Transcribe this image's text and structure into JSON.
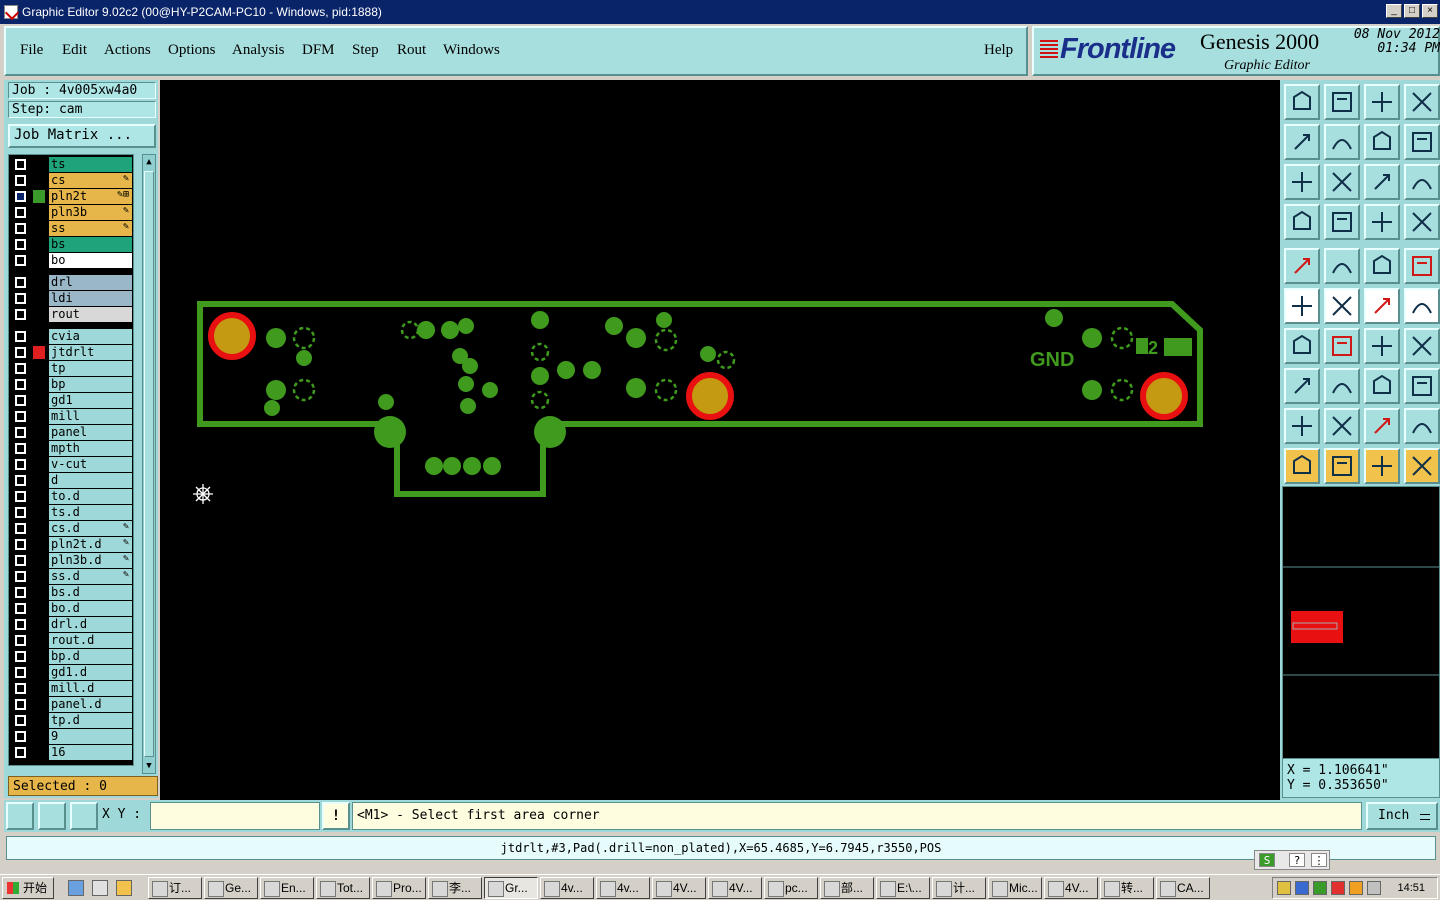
{
  "window": {
    "title": "Graphic Editor 9.02c2 (00@HY-P2CAM-PC10 - Windows, pid:1888)"
  },
  "menu": [
    "File",
    "Edit",
    "Actions",
    "Options",
    "Analysis",
    "DFM",
    "Step",
    "Rout",
    "Windows"
  ],
  "help_label": "Help",
  "brand": {
    "logo": "Frontline",
    "product": "Genesis 2000",
    "subtitle": "Graphic Editor",
    "date": "08 Nov 2012",
    "time": "01:34 PM"
  },
  "job": {
    "job_label": "Job : 4v005xw4a0",
    "step_label": "Step: cam",
    "matrix_button": "Job Matrix ..."
  },
  "layers": [
    {
      "name": "ts",
      "color": "#1fa37a",
      "edit": ""
    },
    {
      "name": "cs",
      "color": "#e6b64a",
      "edit": "✎"
    },
    {
      "name": "pln2t",
      "color": "#e6b64a",
      "edit": "✎⊞",
      "active": true,
      "swatch": "#3a9a2a"
    },
    {
      "name": "pln3b",
      "color": "#e6b64a",
      "edit": "✎"
    },
    {
      "name": "ss",
      "color": "#e6b64a",
      "edit": "✎"
    },
    {
      "name": "bs",
      "color": "#1fa37a",
      "edit": ""
    },
    {
      "name": "bo",
      "color": "#ffffff",
      "edit": ""
    },
    {
      "name": "drl",
      "color": "#9ab7c7",
      "edit": ""
    },
    {
      "name": "ldi",
      "color": "#9ab7c7",
      "edit": ""
    },
    {
      "name": "rout",
      "color": "#d8d8d8",
      "edit": ""
    },
    {
      "name": "cvia",
      "color": "#9fd8d8",
      "edit": ""
    },
    {
      "name": "jtdrlt",
      "color": "#9fd8d8",
      "edit": "",
      "swatch": "#e02020"
    },
    {
      "name": "tp",
      "color": "#9fd8d8",
      "edit": ""
    },
    {
      "name": "bp",
      "color": "#9fd8d8",
      "edit": ""
    },
    {
      "name": "gd1",
      "color": "#9fd8d8",
      "edit": ""
    },
    {
      "name": "mill",
      "color": "#9fd8d8",
      "edit": ""
    },
    {
      "name": "panel",
      "color": "#9fd8d8",
      "edit": ""
    },
    {
      "name": "mpth",
      "color": "#9fd8d8",
      "edit": ""
    },
    {
      "name": "v-cut",
      "color": "#9fd8d8",
      "edit": ""
    },
    {
      "name": "d",
      "color": "#9fd8d8",
      "edit": ""
    },
    {
      "name": "to.d",
      "color": "#9fd8d8",
      "edit": ""
    },
    {
      "name": "ts.d",
      "color": "#9fd8d8",
      "edit": ""
    },
    {
      "name": "cs.d",
      "color": "#9fd8d8",
      "edit": "✎"
    },
    {
      "name": "pln2t.d",
      "color": "#9fd8d8",
      "edit": "✎"
    },
    {
      "name": "pln3b.d",
      "color": "#9fd8d8",
      "edit": "✎"
    },
    {
      "name": "ss.d",
      "color": "#9fd8d8",
      "edit": "✎"
    },
    {
      "name": "bs.d",
      "color": "#9fd8d8",
      "edit": ""
    },
    {
      "name": "bo.d",
      "color": "#9fd8d8",
      "edit": ""
    },
    {
      "name": "drl.d",
      "color": "#9fd8d8",
      "edit": ""
    },
    {
      "name": "rout.d",
      "color": "#9fd8d8",
      "edit": ""
    },
    {
      "name": "bp.d",
      "color": "#9fd8d8",
      "edit": ""
    },
    {
      "name": "gd1.d",
      "color": "#9fd8d8",
      "edit": ""
    },
    {
      "name": "mill.d",
      "color": "#9fd8d8",
      "edit": ""
    },
    {
      "name": "panel.d",
      "color": "#9fd8d8",
      "edit": ""
    },
    {
      "name": "tp.d",
      "color": "#9fd8d8",
      "edit": ""
    },
    {
      "name": "9",
      "color": "#9fd8d8",
      "edit": ""
    },
    {
      "name": "16",
      "color": "#9fd8d8",
      "edit": ""
    }
  ],
  "selected_label": "Selected : 0",
  "canvas": {
    "board_text": "GND",
    "board_num": "2"
  },
  "coords": {
    "x": "X = 1.106641\"",
    "y": "Y = 0.353650\""
  },
  "cmd": {
    "xy_label": "X Y :",
    "xy_value": "",
    "message": "<M1> - Select first area corner",
    "units": "Inch"
  },
  "status": "jtdrlt,#3,Pad(.drill=non_plated),X=65.4685,Y=6.7945,r3550,POS",
  "taskbar": {
    "start": "开始",
    "items": [
      "订...",
      "Ge...",
      "En...",
      "Tot...",
      "Pro...",
      "李...",
      "Gr...",
      "4v...",
      "4v...",
      "4V...",
      "4V...",
      "pc...",
      "部...",
      "E:\\...",
      "计...",
      "Mic...",
      "4V...",
      "转...",
      "CA..."
    ],
    "active_index": 6,
    "clock": "14:51"
  },
  "colors": {
    "board": "#3f9a1e",
    "pad_ring": "#e81010",
    "pad_fill": "#c49a12",
    "panel": "#9fd8d8"
  },
  "tools": [
    "zoom-home-icon",
    "zoom-out-icon",
    "zoom-house-icon",
    "zoom-window-icon",
    "pan-left-icon",
    "pan-right-icon",
    "pan-back-icon",
    "redraw-s-icon",
    "fit-icon",
    "center-icon",
    "scale-1-2-icon",
    "help-question-icon",
    "settings-icon",
    "grid-icon",
    "layer-compare-icon",
    "layer-compare-2-icon",
    "snap-icon",
    "color-icon",
    "ruler-icon",
    "pad-icon",
    "connect-icon",
    "cross-icon",
    "point-to-point-icon",
    "line-point-icon",
    "line-angle-icon",
    "line-icon",
    "arc-icon",
    "feature-icon",
    "pad-add-icon",
    "line-add-icon",
    "move-icon",
    "group-icon",
    "triangle-icon",
    "text-a-icon",
    "text-a2-icon",
    "text-a3-icon",
    "select-arrow-icon",
    "select-arrow-2-icon",
    "select-arrow-3-icon",
    "select-net-icon"
  ]
}
